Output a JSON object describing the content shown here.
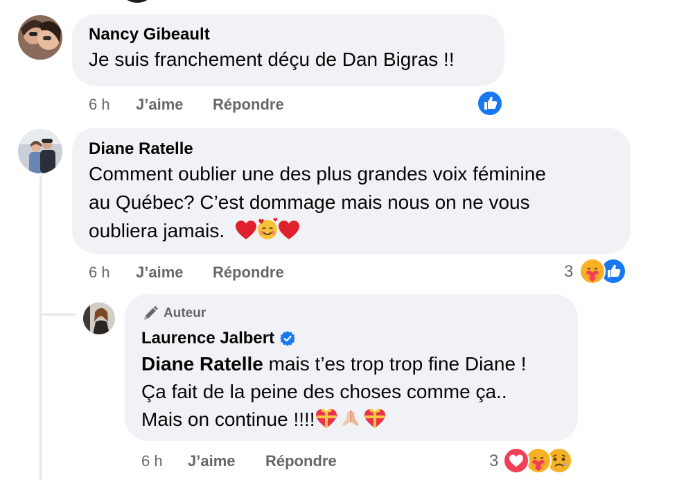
{
  "comments": [
    {
      "author": "Nancy Gibeault",
      "text": "Je suis franchement déçu de Dan Bigras !!",
      "time": "6 h",
      "like": "J’aime",
      "reply": "Répondre",
      "reactions": [
        "like-icon"
      ]
    },
    {
      "author": "Diane Ratelle",
      "text_line1": "Comment oublier une des plus grandes voix féminine",
      "text_line2": "au Québec? C’est dommage mais nous on ne vous",
      "text_line3": "oubliera jamais.",
      "emojis": [
        "heart-icon",
        "smiling-face-with-hearts-icon",
        "heart-icon"
      ],
      "time": "6 h",
      "like": "J’aime",
      "reply": "Répondre",
      "reaction_count": "3",
      "reactions": [
        "care-icon",
        "like-icon"
      ]
    },
    {
      "badge": "Auteur",
      "author": "Laurence Jalbert",
      "verified": true,
      "mention": "Diane Ratelle",
      "text_line1": " mais t’es trop trop fine Diane !",
      "text_line2": "Ça fait de la peine des choses comme ça..",
      "text_line3": "Mais on continue !!!!",
      "emojis": [
        "heart-gift-icon",
        "praying-hands-icon",
        "heart-gift-icon"
      ],
      "time": "6 h",
      "like": "J’aime",
      "reply": "Répondre",
      "reaction_count": "3",
      "reactions": [
        "love-icon",
        "care-icon",
        "sad-icon"
      ]
    }
  ],
  "colors": {
    "bubble": "#f0f2f5",
    "meta": "#65676b",
    "like_blue": "#1877f2",
    "love_red": "#f33e58",
    "care_yellow": "#f7b125"
  }
}
